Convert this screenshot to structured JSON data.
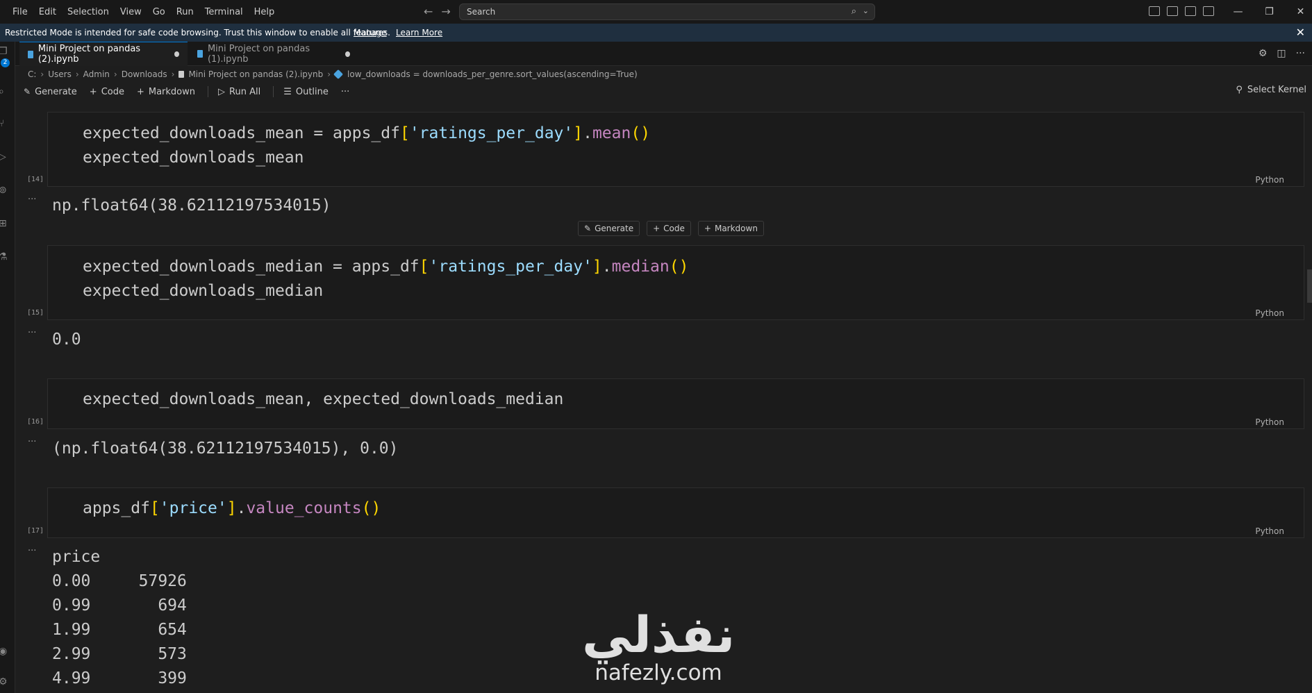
{
  "menu": [
    "File",
    "Edit",
    "Selection",
    "View",
    "Go",
    "Run",
    "Terminal",
    "Help"
  ],
  "search": {
    "placeholder": "Search"
  },
  "banner": {
    "message": "Restricted Mode is intended for safe code browsing. Trust this window to enable all features.",
    "manage": "Manage",
    "learn_more": "Learn More"
  },
  "activity_badge": "2",
  "tabs": [
    {
      "label": "Mini Project on pandas (2).ipynb",
      "active": true
    },
    {
      "label": "Mini Project on pandas (1).ipynb",
      "active": false
    }
  ],
  "breadcrumb": {
    "parts": [
      "C:",
      "Users",
      "Admin",
      "Downloads"
    ],
    "file": "Mini Project on pandas (2).ipynb",
    "symbol": "low_downloads = downloads_per_genre.sort_values(ascending=True)"
  },
  "toolbar": {
    "generate": "Generate",
    "code": "Code",
    "markdown": "Markdown",
    "run_all": "Run All",
    "outline": "Outline",
    "more": "···",
    "kernel": "Select Kernel"
  },
  "insert_bar": {
    "generate": "Generate",
    "code": "Code",
    "markdown": "Markdown"
  },
  "cells": [
    {
      "exec": "[14]",
      "lang": "Python",
      "code": {
        "a1": "expected_downloads_mean = apps_df",
        "b1o": "[",
        "s1": "'ratings_per_day'",
        "b1c": "]",
        "dot1": ".",
        "f1": "mean",
        "p1": "()",
        "line2": "expected_downloads_mean"
      },
      "output": [
        "np.float64(38.62112197534015)"
      ]
    },
    {
      "exec": "[15]",
      "lang": "Python",
      "code": {
        "a1": "expected_downloads_median = apps_df",
        "b1o": "[",
        "s1": "'ratings_per_day'",
        "b1c": "]",
        "dot1": ".",
        "f1": "median",
        "p1": "()",
        "line2": "expected_downloads_median"
      },
      "output": [
        "0.0"
      ]
    },
    {
      "exec": "[16]",
      "lang": "Python",
      "code": {
        "a1": "expected_downloads_mean, expected_downloads_median"
      },
      "output": [
        "(np.float64(38.62112197534015), 0.0)"
      ]
    },
    {
      "exec": "[17]",
      "lang": "Python",
      "code": {
        "a1": "apps_df",
        "b1o": "[",
        "s1": "'price'",
        "b1c": "]",
        "dot1": ".",
        "f1": "value_counts",
        "p1": "()"
      },
      "output": [
        "price",
        "0.00     57926",
        "0.99       694",
        "1.99       654",
        "2.99       573",
        "4.99       399"
      ]
    }
  ],
  "output_ellipsis": "...",
  "watermark": {
    "arabic": "نفذلي",
    "latin": "nafezly.com"
  }
}
